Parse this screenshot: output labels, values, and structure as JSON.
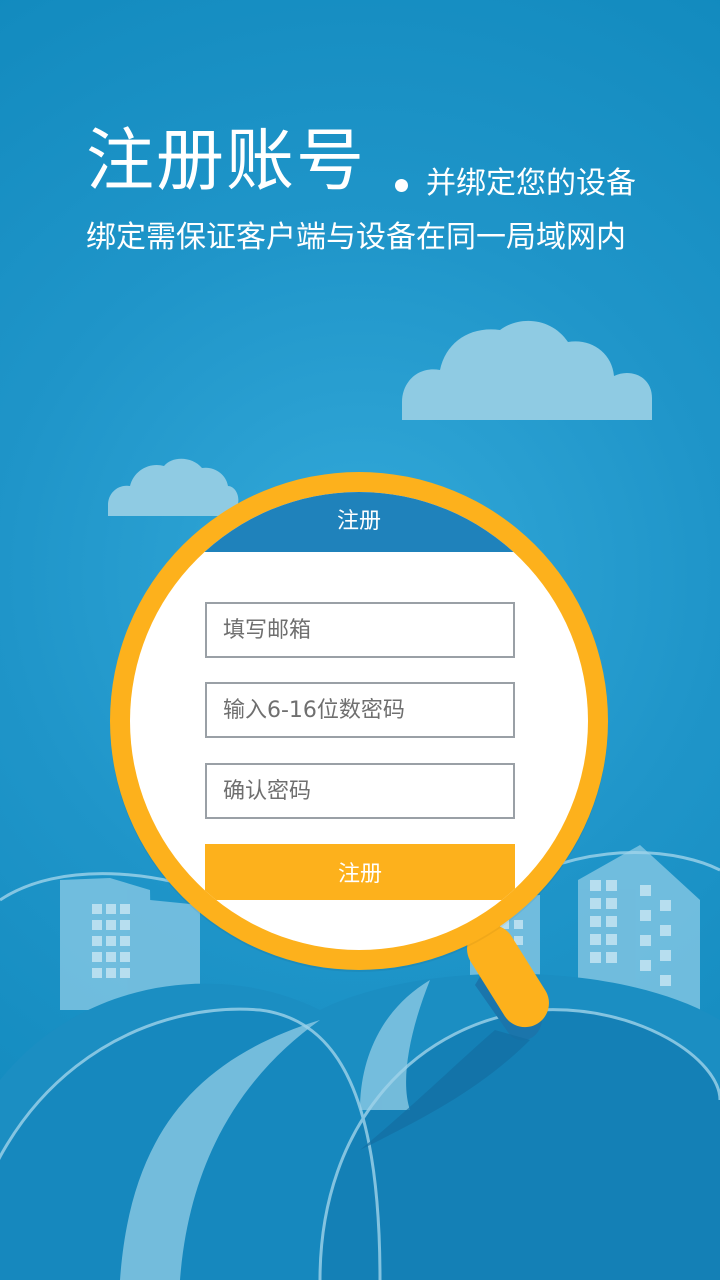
{
  "header": {
    "title": "注册账号",
    "tagline": "并绑定您的设备",
    "note": "绑定需保证客户端与设备在同一局域网内"
  },
  "form": {
    "header_title": "注册",
    "email_placeholder": "填写邮箱",
    "password_placeholder": "输入6-16位数密码",
    "confirm_placeholder": "确认密码",
    "submit_label": "注册"
  },
  "colors": {
    "background": "#1f95c9",
    "accent_orange": "#fdb11c",
    "form_header": "#1f82bb",
    "cloud": "#8fcbe3",
    "building": "#7fc4e2"
  }
}
